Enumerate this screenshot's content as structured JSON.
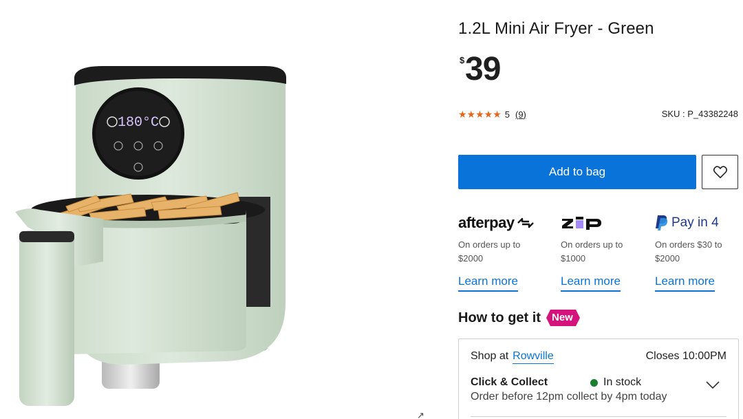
{
  "product": {
    "title": "1.2L Mini Air Fryer - Green",
    "currency_symbol": "$",
    "price": "39",
    "stars": "★★★★★",
    "rating": "5",
    "review_count": "(9)",
    "sku": "SKU : P_43382248",
    "display_reading": "180°C"
  },
  "actions": {
    "add_to_bag": "Add to bag"
  },
  "payments": [
    {
      "name": "afterpay",
      "desc": "On orders up to $2000",
      "link": "Learn more"
    },
    {
      "name": "zip",
      "desc": "On orders up to $1000",
      "link": "Learn more"
    },
    {
      "name": "Pay in 4",
      "desc": "On orders $30 to $2000",
      "link": "Learn more"
    }
  ],
  "fulfilment": {
    "title": "How to get it",
    "badge": "New",
    "shop_at": "Shop at",
    "store": "Rowville",
    "closes": "Closes 10:00PM",
    "method": "Click & Collect",
    "stock": "In stock",
    "detail": "Order before 12pm collect by 4pm today"
  },
  "colors": {
    "accent": "#0a73d9",
    "star": "#e8641b",
    "badge": "#d4147c",
    "in_stock": "#1a7f2e",
    "fryer_body": "#d3e2d2"
  }
}
